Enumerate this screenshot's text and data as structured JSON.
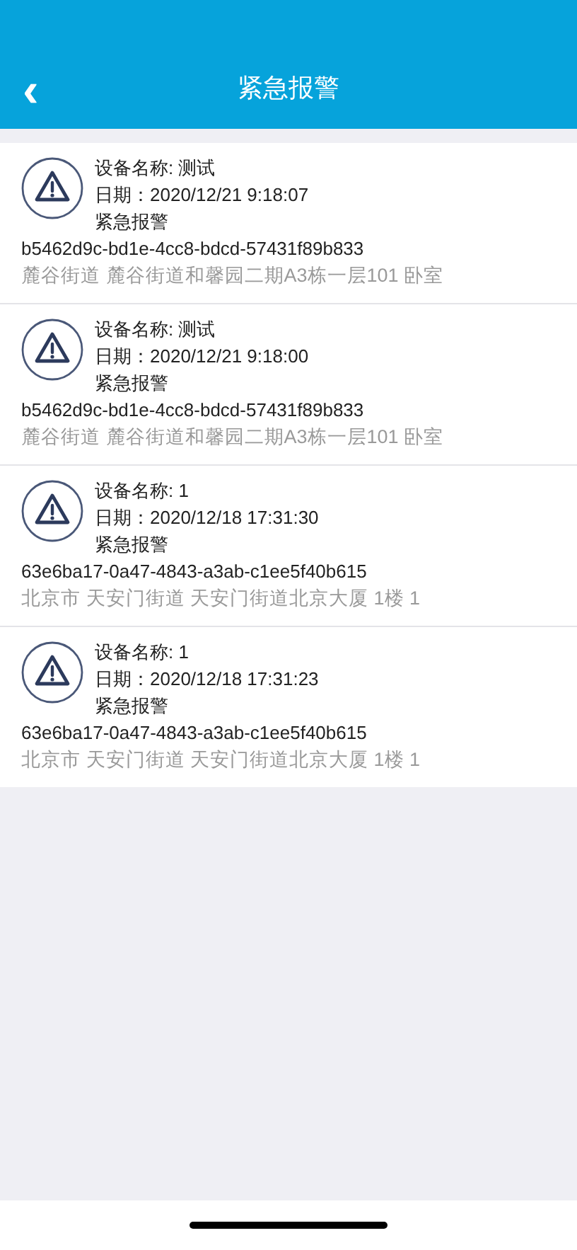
{
  "header": {
    "back": "‹",
    "title": "紧急报警"
  },
  "alarms": [
    {
      "device": "设备名称: 测试",
      "date": "日期：2020/12/21 9:18:07",
      "type": "紧急报警",
      "id": "b5462d9c-bd1e-4cc8-bdcd-57431f89b833",
      "address": "麓谷街道 麓谷街道和馨园二期A3栋一层101 卧室"
    },
    {
      "device": "设备名称: 测试",
      "date": "日期：2020/12/21 9:18:00",
      "type": "紧急报警",
      "id": "b5462d9c-bd1e-4cc8-bdcd-57431f89b833",
      "address": "麓谷街道 麓谷街道和馨园二期A3栋一层101 卧室"
    },
    {
      "device": "设备名称: 1",
      "date": "日期：2020/12/18 17:31:30",
      "type": "紧急报警",
      "id": "63e6ba17-0a47-4843-a3ab-c1ee5f40b615",
      "address": "北京市 天安门街道 天安门街道北京大厦 1楼 1"
    },
    {
      "device": "设备名称: 1",
      "date": "日期：2020/12/18 17:31:23",
      "type": "紧急报警",
      "id": "63e6ba17-0a47-4843-a3ab-c1ee5f40b615",
      "address": "北京市 天安门街道 天安门街道北京大厦 1楼 1"
    }
  ]
}
